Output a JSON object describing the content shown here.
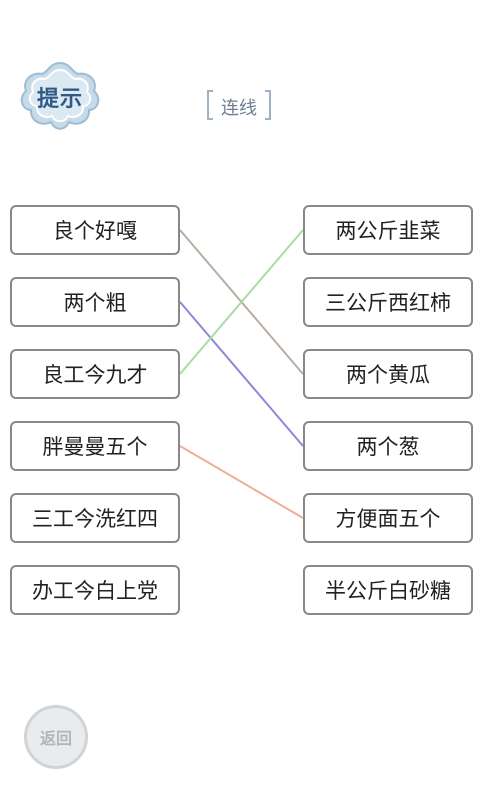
{
  "header": {
    "hint_label": "提示",
    "title": "连线"
  },
  "left_items": [
    {
      "label": "良个好嘎"
    },
    {
      "label": "两个粗"
    },
    {
      "label": "良工今九才"
    },
    {
      "label": "胖曼曼五个"
    },
    {
      "label": "三工今洗红四"
    },
    {
      "label": "办工今白上党"
    }
  ],
  "right_items": [
    {
      "label": "两公斤韭菜"
    },
    {
      "label": "三公斤西红柿"
    },
    {
      "label": "两个黄瓜"
    },
    {
      "label": "两个葱"
    },
    {
      "label": "方便面五个"
    },
    {
      "label": "半公斤白砂糖"
    }
  ],
  "connections": [
    {
      "from": 0,
      "to": 2,
      "color": "#b9ada3"
    },
    {
      "from": 1,
      "to": 3,
      "color": "#8f86d6"
    },
    {
      "from": 2,
      "to": 0,
      "color": "#a9dca1"
    },
    {
      "from": 3,
      "to": 4,
      "color": "#efae93"
    }
  ],
  "footer": {
    "back_label": "返回"
  }
}
